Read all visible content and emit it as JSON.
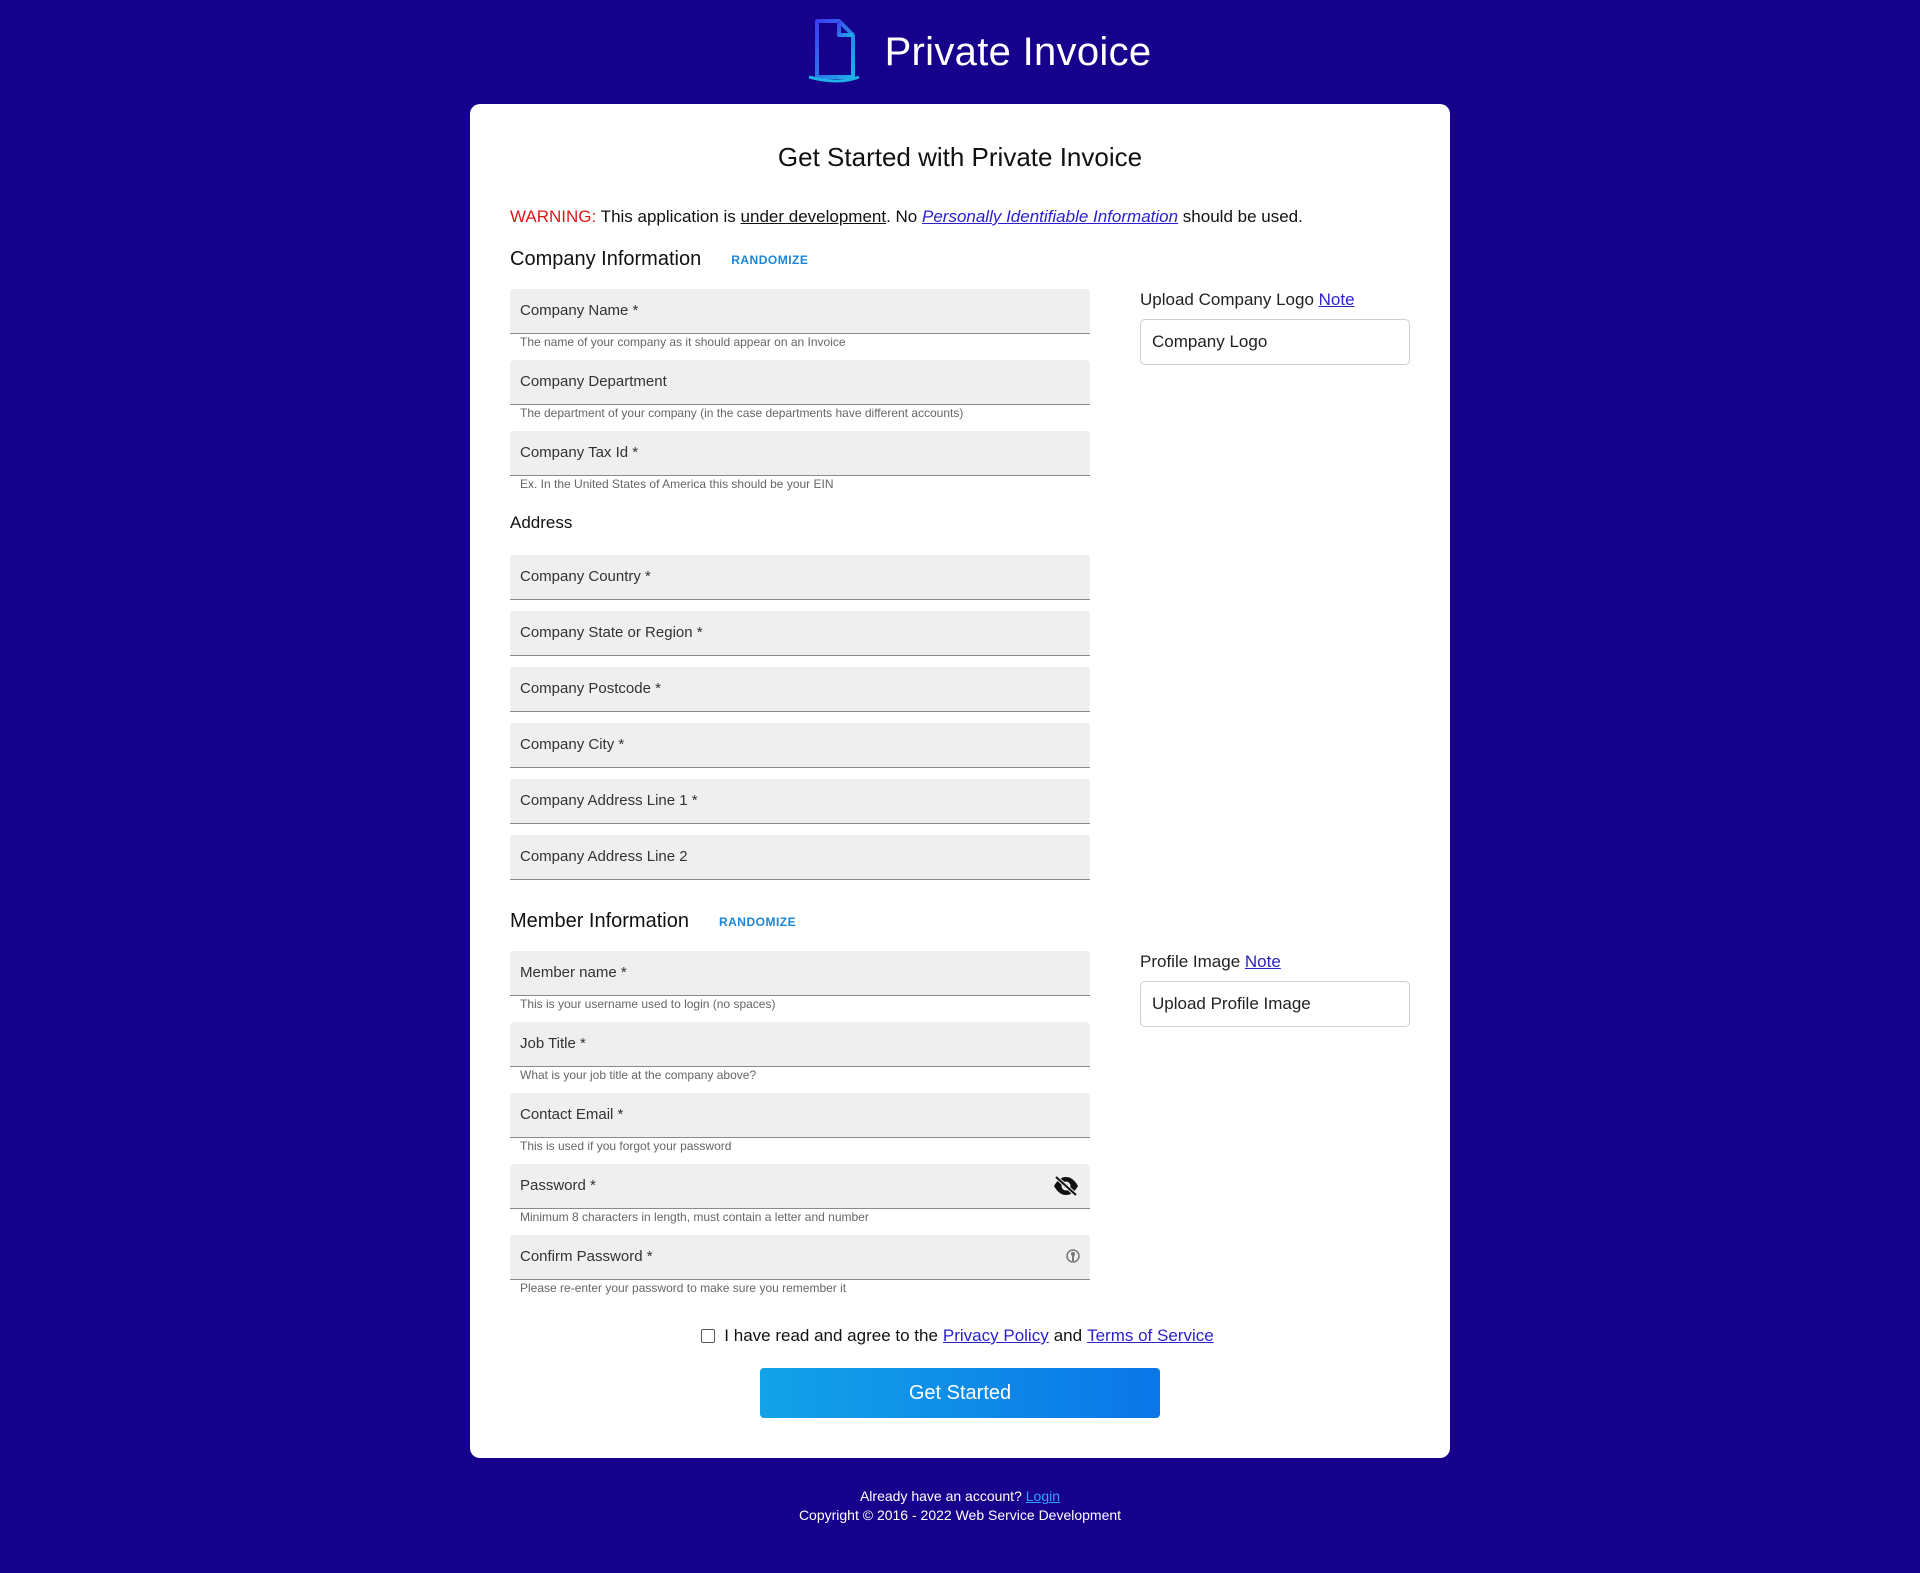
{
  "brand": {
    "name_bold": "Private",
    "name_light": "Invoice"
  },
  "page": {
    "title": "Get Started with Private Invoice"
  },
  "warning": {
    "label": "WARNING:",
    "text1": " This application is ",
    "underlined": "under development",
    "text2": ". No ",
    "link": "Personally Identifiable Information",
    "text3": " should be used."
  },
  "company": {
    "title": "Company Information",
    "randomize": "RANDOMIZE",
    "name": {
      "label": "Company Name *",
      "hint": "The name of your company as it should appear on an Invoice"
    },
    "department": {
      "label": "Company Department",
      "hint": "The department of your company (in the case departments have different accounts)"
    },
    "tax_id": {
      "label": "Company Tax Id *",
      "hint": "Ex. In the United States of America this should be your EIN"
    },
    "logo": {
      "label": "Upload Company Logo",
      "note": "Note",
      "button": "Company Logo"
    }
  },
  "address": {
    "title": "Address",
    "country": "Company Country *",
    "state": "Company State or Region *",
    "postcode": "Company Postcode *",
    "city": "Company City *",
    "line1": "Company Address Line 1 *",
    "line2": "Company Address Line 2"
  },
  "member": {
    "title": "Member Information",
    "randomize": "RANDOMIZE",
    "name": {
      "label": "Member name *",
      "hint": "This is your username used to login (no spaces)"
    },
    "job_title": {
      "label": "Job Title *",
      "hint": "What is your job title at the company above?"
    },
    "email": {
      "label": "Contact Email *",
      "hint": "This is used if you forgot your password"
    },
    "password": {
      "label": "Password *",
      "hint": "Minimum 8 characters in length, must contain a letter and number"
    },
    "confirm": {
      "label": "Confirm Password *",
      "hint": "Please re-enter your password to make sure you remember it"
    },
    "profile": {
      "label": "Profile Image",
      "note": "Note",
      "button": "Upload Profile Image"
    }
  },
  "agreement": {
    "text": "I have read and agree to the",
    "privacy": "Privacy Policy",
    "and": "and",
    "terms": "Terms of Service"
  },
  "cta": {
    "label": "Get Started"
  },
  "footer": {
    "question": "Already have an account?",
    "login": "Login",
    "copyright": "Copyright © 2016 - 2022 Web Service Development"
  }
}
